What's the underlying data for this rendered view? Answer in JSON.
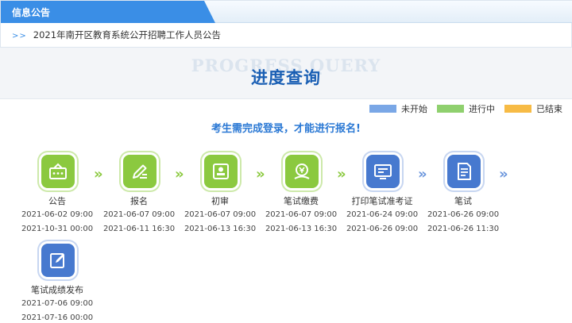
{
  "notice": {
    "title": "信息公告",
    "arrow": ">>",
    "item": "2021年南开区教育系统公开招聘工作人员公告"
  },
  "heading": {
    "background_text": "PROGRESS QUERY",
    "title": "进度查询"
  },
  "legend": [
    {
      "label": "未开始",
      "color": "#7aa7e6"
    },
    {
      "label": "进行中",
      "color": "#8fd06e"
    },
    {
      "label": "已结束",
      "color": "#f7bb45"
    }
  ],
  "login_hint": "考生需完成登录，才能进行报名!",
  "steps": [
    {
      "label": "公告",
      "start": "2021-06-02 09:00",
      "end": "2021-10-31 00:00",
      "icon": "announcement-icon",
      "status_color": "#8bc93f"
    },
    {
      "label": "报名",
      "start": "2021-06-07 09:00",
      "end": "2021-06-11 16:30",
      "icon": "signup-pen-icon",
      "status_color": "#8bc93f"
    },
    {
      "label": "初审",
      "start": "2021-06-07 09:00",
      "end": "2021-06-13 16:30",
      "icon": "review-stamp-icon",
      "status_color": "#8bc93f"
    },
    {
      "label": "笔试缴费",
      "start": "2021-06-07 09:00",
      "end": "2021-06-13 16:30",
      "icon": "payment-icon",
      "status_color": "#8bc93f"
    },
    {
      "label": "打印笔试准考证",
      "start": "2021-06-24 09:00",
      "end": "2021-06-26 09:00",
      "icon": "admission-ticket-icon",
      "status_color": "#4779cf"
    },
    {
      "label": "笔试",
      "start": "2021-06-26 09:00",
      "end": "2021-06-26 11:30",
      "icon": "exam-paper-icon",
      "status_color": "#4779cf"
    },
    {
      "label": "笔试成绩发布",
      "start": "2021-07-06 09:00",
      "end": "2021-07-16 00:00",
      "icon": "score-edit-icon",
      "status_color": "#4779cf"
    }
  ],
  "step_arrow": "»"
}
